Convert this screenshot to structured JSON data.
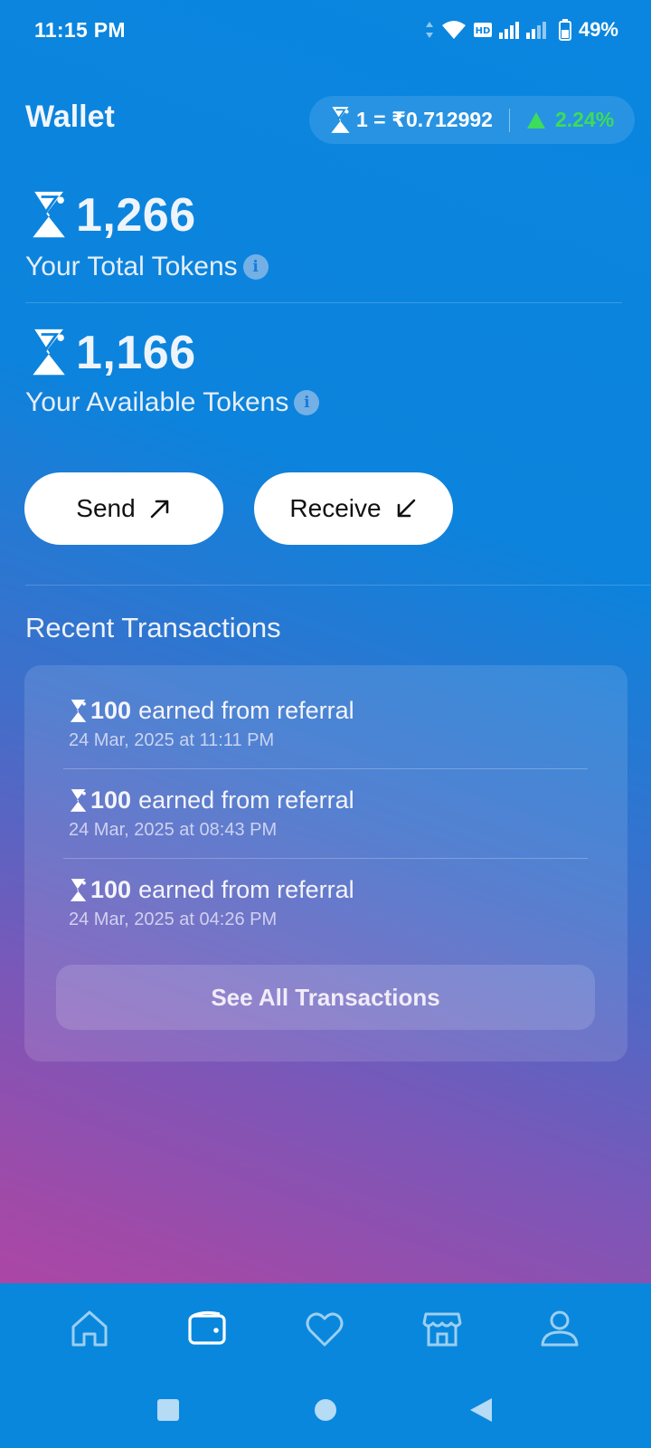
{
  "status_bar": {
    "time": "11:15 PM",
    "battery": "49%"
  },
  "header": {
    "title": "Wallet",
    "rate": "1 = ₹0.712992",
    "change": "2.24%",
    "change_color": "#3ddc5a"
  },
  "tokens": {
    "total_amount": "1,266",
    "total_label": "Your Total Tokens",
    "available_amount": "1,166",
    "available_label": "Your Available Tokens"
  },
  "actions": {
    "send_label": "Send",
    "receive_label": "Receive"
  },
  "transactions": {
    "title": "Recent Transactions",
    "items": [
      {
        "amount": "100",
        "description": "earned from referral",
        "date": "24 Mar, 2025 at 11:11 PM"
      },
      {
        "amount": "100",
        "description": "earned from referral",
        "date": "24 Mar, 2025 at 08:43 PM"
      },
      {
        "amount": "100",
        "description": "earned from referral",
        "date": "24 Mar, 2025 at 04:26 PM"
      }
    ],
    "see_all_label": "See All Transactions"
  },
  "bottom_nav": {
    "items": [
      "home-icon",
      "wallet-icon",
      "heart-icon",
      "store-icon",
      "profile-icon"
    ],
    "active": "wallet-icon"
  },
  "system_nav": [
    "recents-icon",
    "home-circle-icon",
    "back-icon"
  ],
  "colors": {
    "accent_blue": "#0987dd",
    "gradient_pink": "#c23fa3"
  }
}
